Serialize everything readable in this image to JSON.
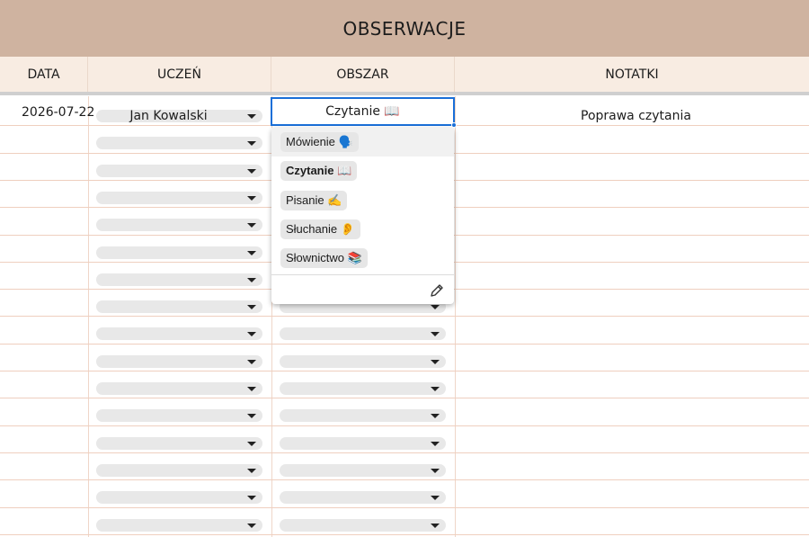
{
  "sheet": {
    "title": "OBSERWACJE"
  },
  "columns": [
    "DATA",
    "UCZEŃ",
    "OBSZAR",
    "NOTATKI"
  ],
  "rows": [
    {
      "date": "2026-07-22",
      "student": "Jan Kowalski",
      "area": "Czytanie 📖",
      "notes": "Poprawa czytania"
    }
  ],
  "dropdown": {
    "options": [
      {
        "label": "Mówienie 🗣️",
        "selected": false,
        "hovered": true
      },
      {
        "label": "Czytanie 📖",
        "selected": true,
        "hovered": false
      },
      {
        "label": "Pisanie ✍️",
        "selected": false,
        "hovered": false
      },
      {
        "label": "Słuchanie 👂",
        "selected": false,
        "hovered": false
      },
      {
        "label": "Słownictwo 📚",
        "selected": false,
        "hovered": false
      }
    ],
    "edit_icon": "pencil-icon"
  },
  "colors": {
    "title_bg": "#cfb3a0",
    "header_bg": "#f8ece2",
    "grid_line": "#efcfbf",
    "active_border": "#1a6fd8",
    "chip_bg": "#e6e6e6"
  }
}
